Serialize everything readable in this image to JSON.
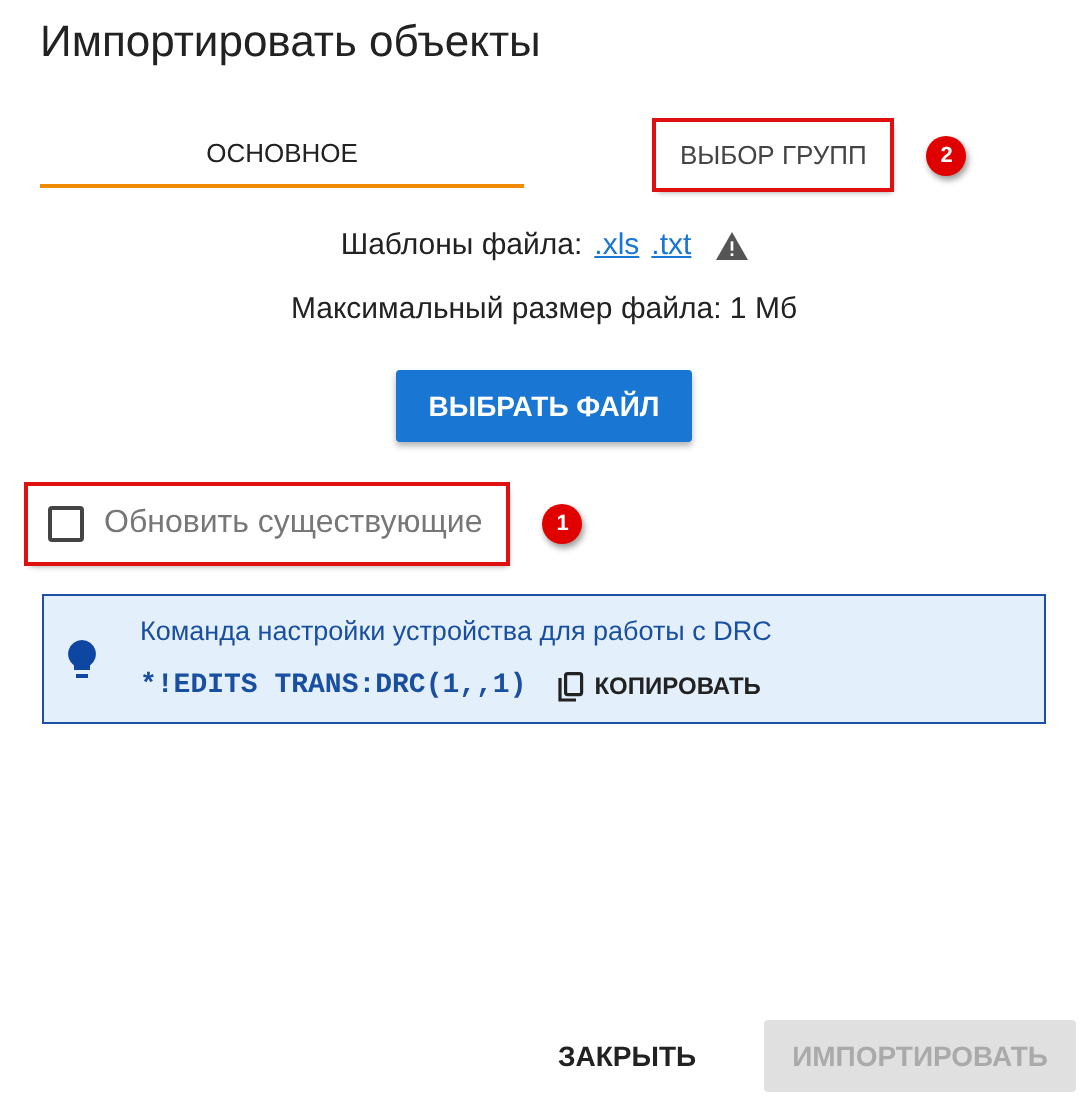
{
  "title": "Импортировать объекты",
  "tabs": [
    {
      "label": "ОСНОВНОЕ",
      "selected": true,
      "highlighted": false
    },
    {
      "label": "ВЫБОР ГРУПП",
      "selected": false,
      "highlighted": true,
      "callout": "2"
    }
  ],
  "templates": {
    "label": "Шаблоны файла:",
    "links": [
      ".xls",
      ".txt"
    ],
    "warning": true
  },
  "max_size": "Максимальный размер файла: 1 Мб",
  "choose_button": "ВЫБРАТЬ ФАЙЛ",
  "update_checkbox": {
    "label": "Обновить существующие",
    "checked": false,
    "highlighted": true,
    "callout": "1"
  },
  "info": {
    "text": "Команда настройки устройства для работы с DRC",
    "command": "*!EDITS TRANS:DRC(1,,1)",
    "copy_button": "КОПИРОВАТЬ"
  },
  "buttons": [
    {
      "label": "ЗАКРЫТЬ",
      "disabled": false
    },
    {
      "label": "ИМПОРТИРОВАТЬ",
      "disabled": true
    }
  ]
}
